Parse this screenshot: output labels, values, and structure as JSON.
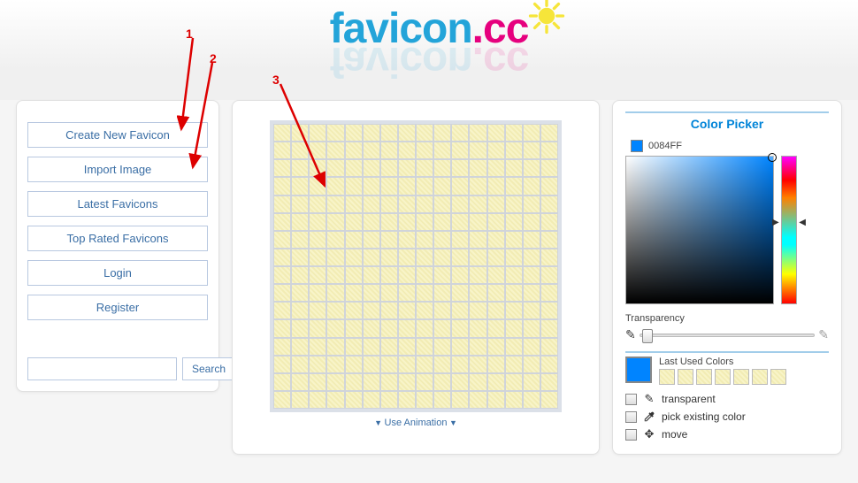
{
  "logo": {
    "part1": "favicon",
    "dot": ".",
    "part2": "cc"
  },
  "sidebar": {
    "items": [
      {
        "label": "Create New Favicon"
      },
      {
        "label": "Import Image"
      },
      {
        "label": "Latest Favicons"
      },
      {
        "label": "Top Rated Favicons"
      },
      {
        "label": "Login"
      },
      {
        "label": "Register"
      }
    ],
    "search_placeholder": "",
    "search_button": "Search"
  },
  "canvas": {
    "grid_size": 16,
    "use_animation_label": "Use Animation"
  },
  "picker": {
    "title": "Color Picker",
    "current_hex": "0084FF",
    "current_color": "#0084ff",
    "transparency_label": "Transparency",
    "last_used_label": "Last Used Colors",
    "tools": {
      "transparent": "transparent",
      "pick_existing": "pick existing color",
      "move": "move"
    }
  },
  "annotations": {
    "n1": "1",
    "n2": "2",
    "n3": "3"
  }
}
